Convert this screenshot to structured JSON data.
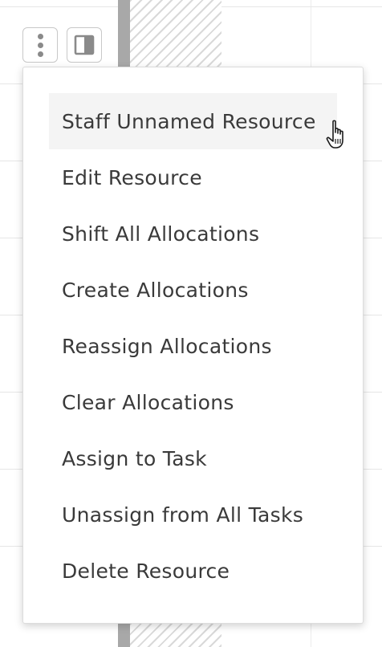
{
  "toolbar": {
    "more_icon": "more-vertical-icon",
    "panel_icon": "side-panel-icon"
  },
  "menu": {
    "items": [
      {
        "label": "Staff Unnamed Resource",
        "hovered": true
      },
      {
        "label": "Edit Resource"
      },
      {
        "label": "Shift All Allocations"
      },
      {
        "label": "Create Allocations"
      },
      {
        "label": "Reassign Allocations"
      },
      {
        "label": "Clear Allocations"
      },
      {
        "label": "Assign to Task"
      },
      {
        "label": "Unassign from All Tasks"
      },
      {
        "label": "Delete Resource"
      }
    ]
  },
  "cursor": {
    "icon": "hand-pointer-icon"
  },
  "colors": {
    "menu_text": "#3a3a3a",
    "hover_bg": "#f4f4f4",
    "allocation_bar": "#a8a8a8"
  }
}
